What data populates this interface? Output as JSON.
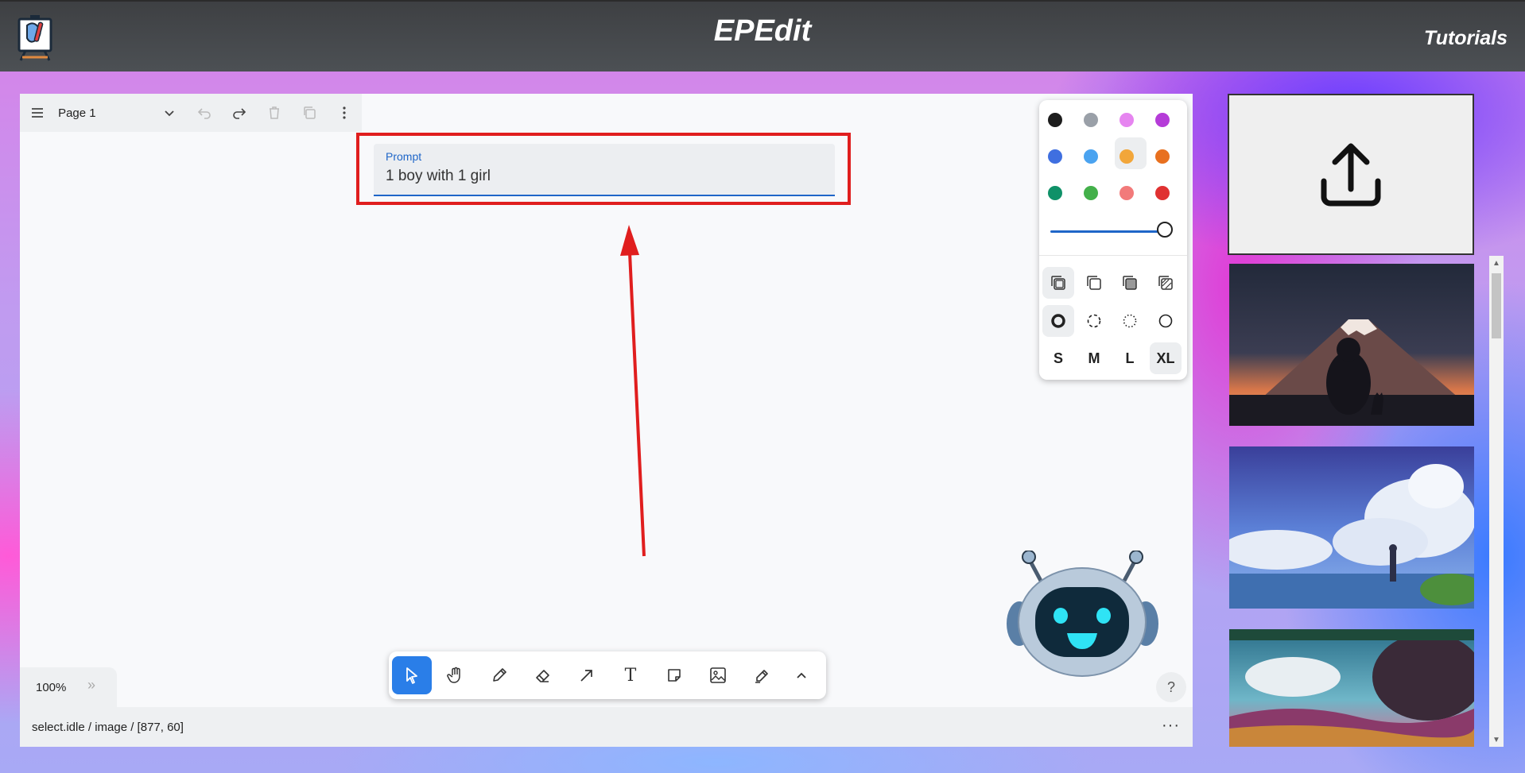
{
  "header": {
    "title": "EPEdit",
    "tutorials_label": "Tutorials"
  },
  "menu": {
    "page_label": "Page 1"
  },
  "prompt": {
    "label": "Prompt",
    "value": "1 boy with 1 girl"
  },
  "style_panel": {
    "colors": [
      "#1d1d1d",
      "#9aa0a8",
      "#e685f0",
      "#b53cd8",
      "#3f6fe0",
      "#4aa3f0",
      "#f2a63a",
      "#e8701f",
      "#0f9168",
      "#43b04a",
      "#f27a7a",
      "#e03131"
    ],
    "selected_color": "#f2a63a",
    "opacity": 1.0,
    "size_labels": [
      "S",
      "M",
      "L",
      "XL"
    ],
    "selected_size": "XL"
  },
  "zoom": {
    "value": "100%",
    "more": "»"
  },
  "toolbar": {
    "tools": [
      "select-tool",
      "hand-tool",
      "draw-tool",
      "eraser-tool",
      "arrow-tool",
      "text-tool",
      "note-tool",
      "image-tool",
      "highlight-tool",
      "more-tools"
    ],
    "text_icon": "T",
    "selected": "select-tool"
  },
  "status": {
    "text": "select.idle / image / [877, 60]",
    "more": "···"
  },
  "help": {
    "label": "?"
  },
  "colors": {
    "accent": "#2a7ee8",
    "annotation": "#e01e1e",
    "header_bg": "#45484b"
  }
}
